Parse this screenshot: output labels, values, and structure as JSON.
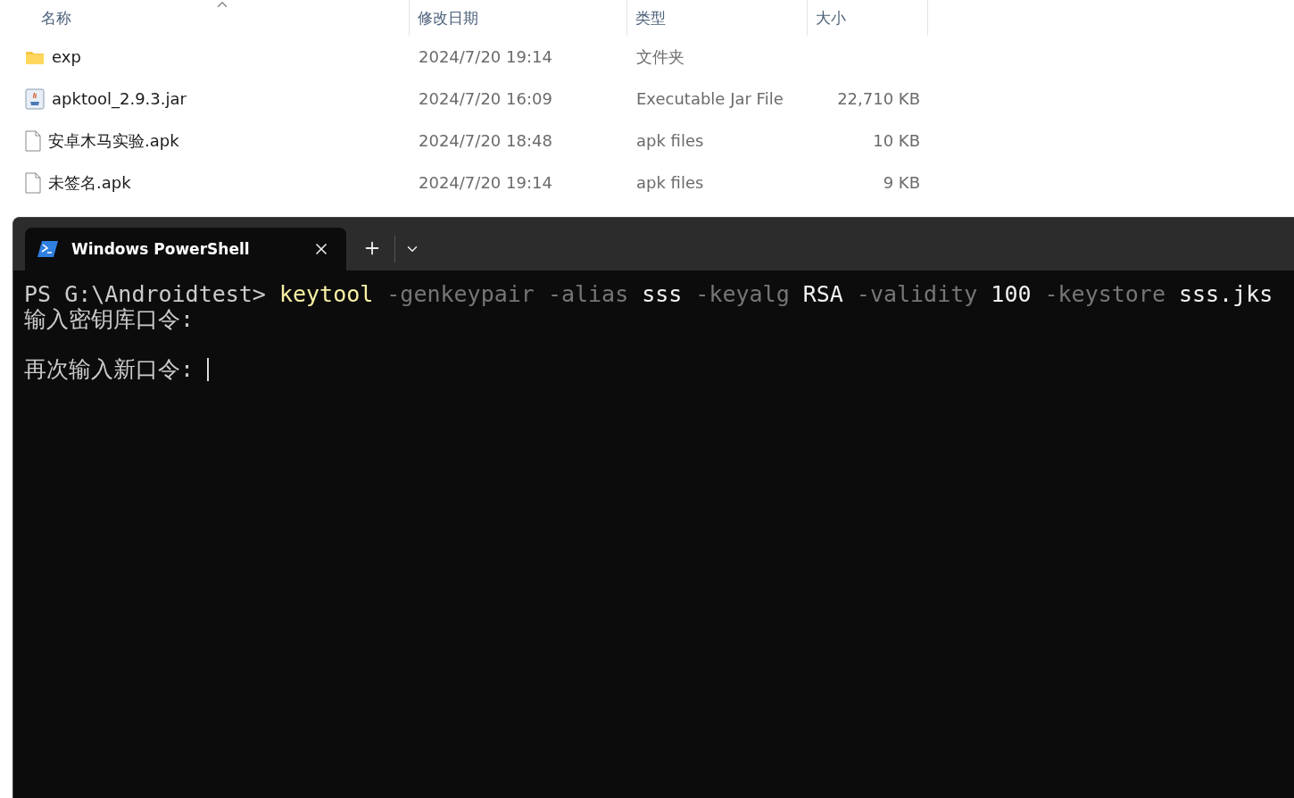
{
  "explorer": {
    "columns": [
      {
        "label": "名称",
        "sorted": true
      },
      {
        "label": "修改日期",
        "sorted": false
      },
      {
        "label": "类型",
        "sorted": false
      },
      {
        "label": "大小",
        "sorted": false
      }
    ],
    "rows": [
      {
        "kind": "folder",
        "name": "exp",
        "modified": "2024/7/20 19:14",
        "type": "文件夹"
      },
      {
        "kind": "jar",
        "name": "apktool_2.9.3.jar",
        "modified": "2024/7/20 16:09",
        "type": "Executable Jar File",
        "size": "22,710 KB"
      },
      {
        "kind": "file",
        "name": "安卓木马实验.apk",
        "modified": "2024/7/20 18:48",
        "type": "apk files",
        "size": "10 KB"
      },
      {
        "kind": "file",
        "name": "未签名.apk",
        "modified": "2024/7/20 19:14",
        "type": "apk files",
        "size": "9 KB"
      }
    ]
  },
  "terminal": {
    "tabs": [
      {
        "title": "Windows PowerShell",
        "selected": true
      }
    ],
    "lines": [
      {
        "tokens": [
          {
            "kind": "prompt",
            "text": "PS G:\\Androidtest>"
          },
          {
            "kind": "command",
            "text": "keytool"
          },
          {
            "kind": "param",
            "text": "-genkeypair"
          },
          {
            "kind": "param",
            "text": "-alias"
          },
          {
            "kind": "arg",
            "text": "sss"
          },
          {
            "kind": "param",
            "text": "-keyalg"
          },
          {
            "kind": "arg",
            "text": "RSA"
          },
          {
            "kind": "param",
            "text": "-validity"
          },
          {
            "kind": "arg",
            "text": "100"
          },
          {
            "kind": "param",
            "text": "-keystore"
          },
          {
            "kind": "arg",
            "text": "sss.jks"
          }
        ],
        "cursor": false
      },
      {
        "tokens": [
          {
            "kind": "output",
            "text": "输入密钥库口令:"
          }
        ],
        "cursor": false
      },
      {
        "cursor": false
      },
      {
        "tokens": [
          {
            "kind": "output",
            "text": "再次输入新口令:"
          }
        ],
        "cursor": true
      }
    ]
  }
}
